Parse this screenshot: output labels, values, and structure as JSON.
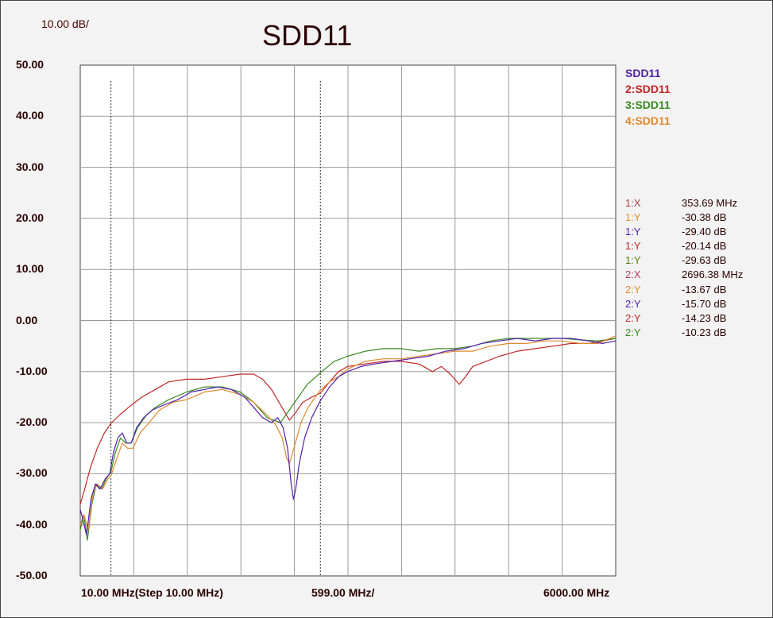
{
  "header": {
    "scale_label": "10.00 dB/",
    "title": "SDD11"
  },
  "legend": [
    {
      "label": "SDD11",
      "color": "#5020b0"
    },
    {
      "label": "2:SDD11",
      "color": "#c02828"
    },
    {
      "label": "3:SDD11",
      "color": "#3a8a20"
    },
    {
      "label": "4:SDD11",
      "color": "#e08a30"
    }
  ],
  "markers": [
    {
      "name": "1:X",
      "value": "353.69 MHz",
      "color": "#b04040"
    },
    {
      "name": "1:Y",
      "value": "-30.38 dB",
      "color": "#e08a30"
    },
    {
      "name": "1:Y",
      "value": "-29.40 dB",
      "color": "#5020b0"
    },
    {
      "name": "1:Y",
      "value": "-20.14 dB",
      "color": "#c02828"
    },
    {
      "name": "1:Y",
      "value": "-29.63 dB",
      "color": "#5a7a10"
    },
    {
      "name": "2:X",
      "value": "2696.38 MHz",
      "color": "#b04060"
    },
    {
      "name": "2:Y",
      "value": "-13.67 dB",
      "color": "#e08a30"
    },
    {
      "name": "2:Y",
      "value": "-15.70 dB",
      "color": "#5020b0"
    },
    {
      "name": "2:Y",
      "value": "-14.23 dB",
      "color": "#c02828"
    },
    {
      "name": "2:Y",
      "value": "-10.23 dB",
      "color": "#3a8a20"
    }
  ],
  "x_axis": {
    "start_label": "10.00 MHz(Step 10.00 MHz)",
    "div_label": "599.00 MHz/",
    "stop_label": "6000.00 MHz"
  },
  "chart_data": {
    "type": "line",
    "title": "SDD11",
    "xlim": [
      10,
      6000
    ],
    "ylim": [
      -50,
      50
    ],
    "grid": true,
    "legend_position": "top-right",
    "yticks": [
      "50.00",
      "40.00",
      "30.00",
      "20.00",
      "10.00",
      "0.00",
      "-10.00",
      "-20.00",
      "-30.00",
      "-40.00",
      "-50.00"
    ],
    "marker_x": [
      353.69,
      2696.38
    ],
    "series": [
      {
        "name": "SDD11",
        "color": "#5020b0",
        "points": [
          [
            10,
            -37
          ],
          [
            40,
            -39
          ],
          [
            80,
            -42
          ],
          [
            130,
            -35
          ],
          [
            180,
            -32
          ],
          [
            230,
            -33
          ],
          [
            290,
            -31
          ],
          [
            340,
            -30
          ],
          [
            380,
            -26
          ],
          [
            430,
            -23
          ],
          [
            480,
            -22
          ],
          [
            530,
            -24
          ],
          [
            580,
            -24
          ],
          [
            640,
            -21
          ],
          [
            720,
            -19
          ],
          [
            820,
            -17.5
          ],
          [
            950,
            -16.5
          ],
          [
            1100,
            -15.5
          ],
          [
            1250,
            -14
          ],
          [
            1400,
            -13.5
          ],
          [
            1550,
            -13
          ],
          [
            1700,
            -13.5
          ],
          [
            1850,
            -15
          ],
          [
            1950,
            -17
          ],
          [
            2050,
            -19
          ],
          [
            2150,
            -20
          ],
          [
            2220,
            -19
          ],
          [
            2280,
            -21
          ],
          [
            2330,
            -25
          ],
          [
            2370,
            -32
          ],
          [
            2395,
            -35
          ],
          [
            2420,
            -33
          ],
          [
            2460,
            -28
          ],
          [
            2520,
            -23
          ],
          [
            2600,
            -19
          ],
          [
            2696,
            -15.7
          ],
          [
            2800,
            -13
          ],
          [
            2900,
            -11
          ],
          [
            3000,
            -10
          ],
          [
            3150,
            -9
          ],
          [
            3300,
            -8.5
          ],
          [
            3500,
            -8
          ],
          [
            3700,
            -7.5
          ],
          [
            3900,
            -7
          ],
          [
            4100,
            -6
          ],
          [
            4300,
            -5.5
          ],
          [
            4500,
            -4.5
          ],
          [
            4700,
            -4
          ],
          [
            4900,
            -3.5
          ],
          [
            5100,
            -4
          ],
          [
            5300,
            -3.5
          ],
          [
            5500,
            -3.5
          ],
          [
            5700,
            -4
          ],
          [
            5850,
            -4.5
          ],
          [
            6000,
            -4
          ]
        ]
      },
      {
        "name": "2:SDD11",
        "color": "#c02828",
        "points": [
          [
            10,
            -36
          ],
          [
            60,
            -33
          ],
          [
            120,
            -29
          ],
          [
            200,
            -25
          ],
          [
            280,
            -22
          ],
          [
            353.69,
            -20.14
          ],
          [
            450,
            -18.5
          ],
          [
            550,
            -17
          ],
          [
            700,
            -15
          ],
          [
            850,
            -13.5
          ],
          [
            1000,
            -12
          ],
          [
            1200,
            -11.5
          ],
          [
            1400,
            -11.5
          ],
          [
            1600,
            -11
          ],
          [
            1800,
            -10.5
          ],
          [
            1950,
            -10.5
          ],
          [
            2050,
            -11.5
          ],
          [
            2150,
            -13.5
          ],
          [
            2250,
            -16.5
          ],
          [
            2350,
            -19.5
          ],
          [
            2420,
            -18
          ],
          [
            2500,
            -16
          ],
          [
            2600,
            -15
          ],
          [
            2696,
            -14.23
          ],
          [
            2800,
            -12
          ],
          [
            2900,
            -10
          ],
          [
            3000,
            -9
          ],
          [
            3200,
            -8.5
          ],
          [
            3400,
            -8
          ],
          [
            3600,
            -8
          ],
          [
            3800,
            -8.5
          ],
          [
            3950,
            -10
          ],
          [
            4050,
            -9
          ],
          [
            4150,
            -10.5
          ],
          [
            4250,
            -12.5
          ],
          [
            4320,
            -11
          ],
          [
            4400,
            -9
          ],
          [
            4550,
            -8
          ],
          [
            4700,
            -7
          ],
          [
            4900,
            -6
          ],
          [
            5100,
            -5.5
          ],
          [
            5300,
            -5
          ],
          [
            5500,
            -4.5
          ],
          [
            5700,
            -4.5
          ],
          [
            5850,
            -4
          ],
          [
            6000,
            -3.5
          ]
        ]
      },
      {
        "name": "3:SDD11",
        "color": "#3a8a20",
        "points": [
          [
            10,
            -41
          ],
          [
            50,
            -38
          ],
          [
            90,
            -43
          ],
          [
            140,
            -36
          ],
          [
            190,
            -32
          ],
          [
            250,
            -33
          ],
          [
            300,
            -31
          ],
          [
            353.69,
            -29.63
          ],
          [
            400,
            -26
          ],
          [
            460,
            -23
          ],
          [
            520,
            -24
          ],
          [
            580,
            -24
          ],
          [
            650,
            -21
          ],
          [
            750,
            -18.5
          ],
          [
            850,
            -17
          ],
          [
            1000,
            -15.5
          ],
          [
            1200,
            -14
          ],
          [
            1400,
            -13
          ],
          [
            1600,
            -13
          ],
          [
            1800,
            -14
          ],
          [
            1950,
            -16
          ],
          [
            2100,
            -19
          ],
          [
            2250,
            -20
          ],
          [
            2350,
            -17.5
          ],
          [
            2450,
            -15
          ],
          [
            2550,
            -12.5
          ],
          [
            2696,
            -10.23
          ],
          [
            2850,
            -8
          ],
          [
            3000,
            -7
          ],
          [
            3200,
            -6
          ],
          [
            3400,
            -5.5
          ],
          [
            3600,
            -5.5
          ],
          [
            3800,
            -6
          ],
          [
            4000,
            -5.5
          ],
          [
            4200,
            -5.5
          ],
          [
            4400,
            -5
          ],
          [
            4600,
            -4
          ],
          [
            4800,
            -3.5
          ],
          [
            5000,
            -3.5
          ],
          [
            5200,
            -3.5
          ],
          [
            5400,
            -3.5
          ],
          [
            5600,
            -3.8
          ],
          [
            5800,
            -4
          ],
          [
            6000,
            -3.5
          ]
        ]
      },
      {
        "name": "4:SDD11",
        "color": "#e08a30",
        "points": [
          [
            10,
            -40
          ],
          [
            50,
            -38
          ],
          [
            100,
            -41
          ],
          [
            150,
            -34
          ],
          [
            200,
            -32
          ],
          [
            260,
            -33
          ],
          [
            320,
            -31
          ],
          [
            353.69,
            -30.38
          ],
          [
            420,
            -27
          ],
          [
            480,
            -24
          ],
          [
            540,
            -25
          ],
          [
            600,
            -25
          ],
          [
            680,
            -22
          ],
          [
            780,
            -20
          ],
          [
            900,
            -17.5
          ],
          [
            1050,
            -16
          ],
          [
            1200,
            -15.5
          ],
          [
            1400,
            -14
          ],
          [
            1600,
            -13.5
          ],
          [
            1800,
            -14.5
          ],
          [
            1950,
            -16
          ],
          [
            2100,
            -18.5
          ],
          [
            2200,
            -20.5
          ],
          [
            2270,
            -23
          ],
          [
            2320,
            -27
          ],
          [
            2350,
            -28
          ],
          [
            2400,
            -25
          ],
          [
            2480,
            -20
          ],
          [
            2560,
            -17
          ],
          [
            2640,
            -15
          ],
          [
            2696,
            -13.67
          ],
          [
            2800,
            -12
          ],
          [
            2900,
            -11
          ],
          [
            3000,
            -9.5
          ],
          [
            3200,
            -8
          ],
          [
            3400,
            -7.5
          ],
          [
            3600,
            -7.5
          ],
          [
            3800,
            -7
          ],
          [
            4000,
            -6.5
          ],
          [
            4200,
            -6
          ],
          [
            4400,
            -6
          ],
          [
            4600,
            -5
          ],
          [
            4800,
            -4.5
          ],
          [
            5000,
            -4.5
          ],
          [
            5200,
            -4
          ],
          [
            5400,
            -4
          ],
          [
            5600,
            -4.5
          ],
          [
            5800,
            -4.5
          ],
          [
            6000,
            -3
          ]
        ]
      }
    ]
  }
}
